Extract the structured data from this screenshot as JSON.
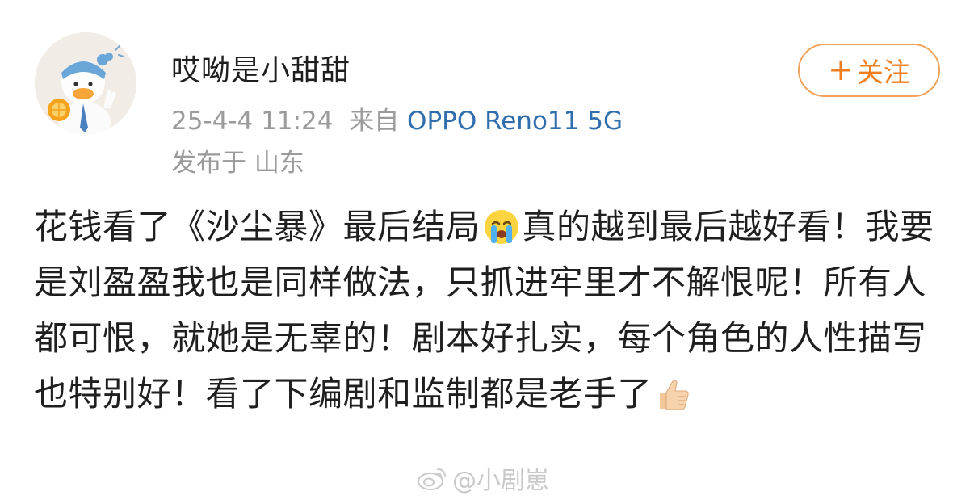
{
  "post": {
    "username": "哎呦是小甜甜",
    "timestamp": "25-4-4 11:24",
    "source_prefix": "来自",
    "device": "OPPO Reno11 5G",
    "location": "发布于 山东",
    "follow_button": {
      "plus": "+",
      "label": "关注"
    },
    "content": {
      "part1": "花钱看了《沙尘暴》最后结局",
      "emoji1": "crying-face-emoji",
      "part2": "真的越到最后越好看！我要是刘盈盈我也是同样做法，只抓进牢里才不解恨呢！所有人都可恨，就她是无辜的！剧本好扎实，每个角色的人性描写也特别好！看了下编剧和监制都是老手了",
      "emoji2": "thumbs-up-emoji"
    }
  },
  "watermark": {
    "text": "@小剧崽",
    "icon": "weibo-icon"
  },
  "colors": {
    "follow_orange": "#f07d1e",
    "device_blue": "#2f6dac",
    "meta_gray": "#9b9b9b"
  }
}
